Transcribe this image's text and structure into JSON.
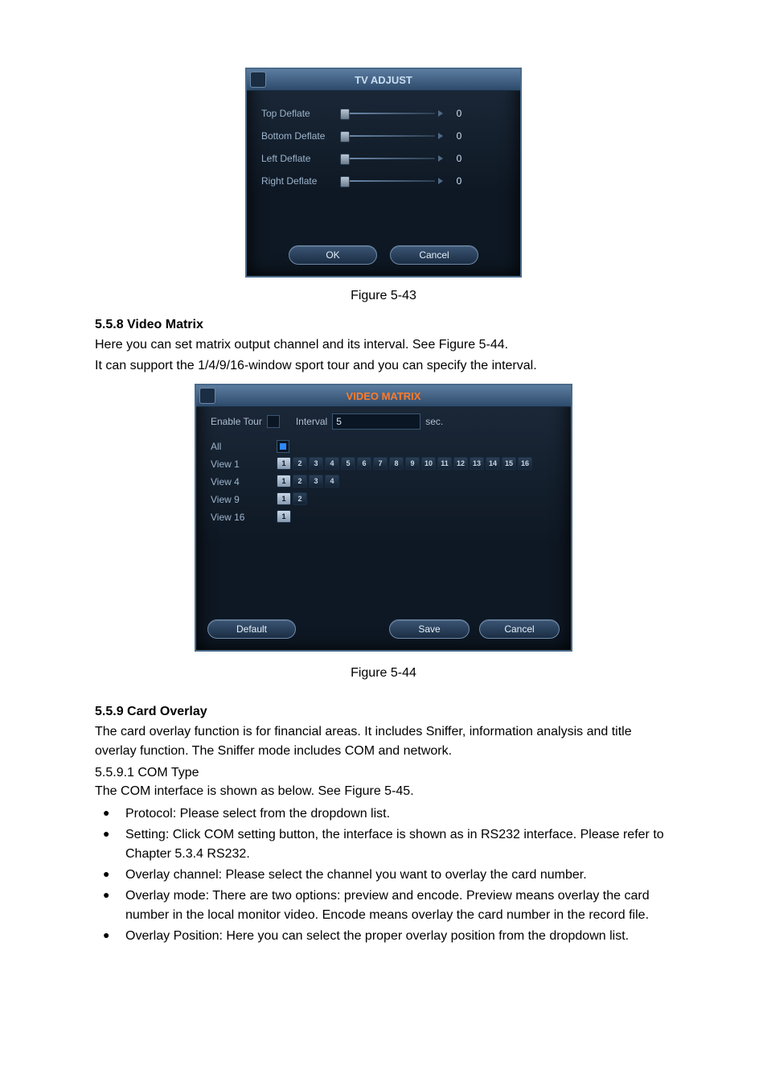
{
  "tv_adjust": {
    "title": "TV ADJUST",
    "rows": [
      {
        "label": "Top Deflate",
        "value": "0"
      },
      {
        "label": "Bottom Deflate",
        "value": "0"
      },
      {
        "label": "Left Deflate",
        "value": "0"
      },
      {
        "label": "Right Deflate",
        "value": "0"
      }
    ],
    "ok": "OK",
    "cancel": "Cancel"
  },
  "figure_43": "Figure 5-43",
  "sec_558": {
    "heading": "5.5.8  Video Matrix",
    "line1": "Here you can set matrix output channel and its interval. See Figure 5-44.",
    "line2": "It can support the 1/4/9/16-window sport tour and you can specify the interval."
  },
  "video_matrix": {
    "title": "VIDEO MATRIX",
    "enable_tour_label": "Enable Tour",
    "enable_tour_checked": false,
    "interval_label": "Interval",
    "interval_value": "5",
    "interval_unit": "sec.",
    "rows": {
      "all": {
        "label": "All"
      },
      "view1": {
        "label": "View 1"
      },
      "view4": {
        "label": "View 4"
      },
      "view9": {
        "label": "View 9"
      },
      "view16": {
        "label": "View 16"
      }
    },
    "default": "Default",
    "save": "Save",
    "cancel": "Cancel"
  },
  "figure_44": "Figure 5-44",
  "sec_559": {
    "heading": "5.5.9  Card Overlay",
    "intro1": "The card overlay function is for financial areas. It includes Sniffer, information analysis and title overlay function. The Sniffer mode includes COM and network.",
    "sub": "5.5.9.1  COM Type",
    "sub_line": "The COM interface is shown as below. See Figure 5-45.",
    "bullets": [
      " Protocol: Please select from the dropdown list.",
      "Setting: Click COM setting button, the interface is shown as in RS232 interface. Please refer to Chapter 5.3.4 RS232.",
      "Overlay channel: Please select the channel you want to overlay the card number.",
      "Overlay mode: There are two options: preview and encode. Preview means overlay the card number in the local monitor video. Encode means overlay the card number in the record file.",
      "Overlay Position: Here you can select the proper overlay position from the dropdown list."
    ]
  }
}
